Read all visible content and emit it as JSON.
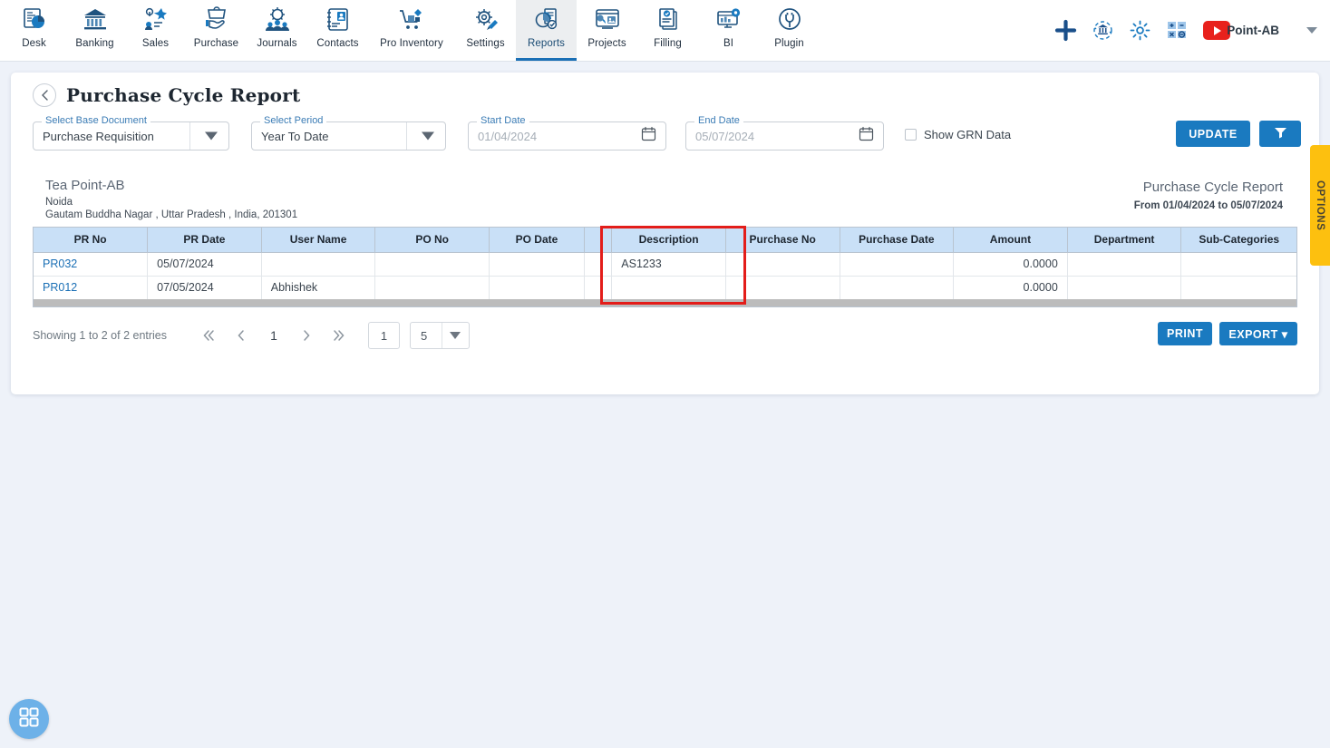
{
  "topnav": {
    "items": [
      {
        "label": "Desk",
        "icon": "dashboard-icon",
        "active": false
      },
      {
        "label": "Banking",
        "icon": "bank-icon",
        "active": false
      },
      {
        "label": "Sales",
        "icon": "sales-icon",
        "active": false
      },
      {
        "label": "Purchase",
        "icon": "purchase-icon",
        "active": false
      },
      {
        "label": "Journals",
        "icon": "journals-icon",
        "active": false
      },
      {
        "label": "Contacts",
        "icon": "contacts-icon",
        "active": false
      },
      {
        "label": "Pro Inventory",
        "icon": "inventory-icon",
        "active": false
      },
      {
        "label": "Settings",
        "icon": "settings-tools-icon",
        "active": false
      },
      {
        "label": "Reports",
        "icon": "reports-icon",
        "active": true
      },
      {
        "label": "Projects",
        "icon": "projects-icon",
        "active": false
      },
      {
        "label": "Filling",
        "icon": "filling-icon",
        "active": false
      },
      {
        "label": "BI",
        "icon": "bi-icon",
        "active": false
      },
      {
        "label": "Plugin",
        "icon": "plugin-icon",
        "active": false
      }
    ],
    "right": {
      "add_icon": "plus-icon",
      "sync_icon": "bank-sync-icon",
      "settings_icon": "gear-icon",
      "calculator_icon": "calculator-icon",
      "youtube_icon": "youtube-icon",
      "user_name": "Point-AB",
      "caret_icon": "chevron-down-icon"
    }
  },
  "page": {
    "back_icon": "chevron-left-icon",
    "title": "Purchase Cycle Report"
  },
  "filters": {
    "base_document": {
      "label": "Select Base Document",
      "value": "Purchase Requisition"
    },
    "period": {
      "label": "Select Period",
      "value": "Year To Date"
    },
    "start_date": {
      "label": "Start Date",
      "value": "01/04/2024",
      "icon": "calendar-icon"
    },
    "end_date": {
      "label": "End Date",
      "value": "05/07/2024",
      "icon": "calendar-icon"
    },
    "show_grn": {
      "label": "Show GRN Data",
      "checked": false
    },
    "update_label": "UPDATE",
    "filter_icon": "funnel-icon"
  },
  "report": {
    "org_name": "Tea Point-AB",
    "org_city": "Noida",
    "org_address": "Gautam Buddha Nagar , Uttar Pradesh , India, 201301",
    "title": "Purchase Cycle Report",
    "range": "From 01/04/2024 to 05/07/2024"
  },
  "table": {
    "columns": [
      "PR No",
      "PR Date",
      "User Name",
      "PO No",
      "PO Date",
      "",
      "Description",
      "Purchase No",
      "Purchase Date",
      "Amount",
      "Department",
      "Sub-Categories"
    ],
    "rows": [
      {
        "pr_no": "PR032",
        "pr_date": "05/07/2024",
        "user_name": "",
        "po_no": "",
        "po_date": "",
        "blank": "",
        "description": "AS1233",
        "purchase_no": "",
        "purchase_date": "",
        "amount": "0.0000",
        "department": "",
        "sub_categories": ""
      },
      {
        "pr_no": "PR012",
        "pr_date": "07/05/2024",
        "user_name": "Abhishek",
        "po_no": "",
        "po_date": "",
        "blank": "",
        "description": "",
        "purchase_no": "",
        "purchase_date": "",
        "amount": "0.0000",
        "department": "",
        "sub_categories": ""
      }
    ],
    "highlight": {
      "color": "#e31d1a",
      "columns": [
        "",
        "Description"
      ]
    }
  },
  "footer": {
    "showing": "Showing 1 to 2 of 2 entries",
    "first_icon": "double-chevron-left-icon",
    "prev_icon": "chevron-left-icon",
    "current_page": "1",
    "next_icon": "chevron-right-icon",
    "last_icon": "double-chevron-right-icon",
    "page_input_value": "1",
    "page_size_value": "5",
    "print_label": "PRINT",
    "export_label": "EXPORT ▾"
  },
  "options_tab": {
    "label": "OPTIONS",
    "color": "#fdc00f"
  },
  "fab": {
    "icon": "grid-apps-icon"
  },
  "colors": {
    "accent": "#1a7ac0",
    "link": "#1a6fb5",
    "table_header": "#c9e0f7",
    "page_bg": "#eef2f9",
    "highlight": "#e31d1a",
    "options": "#fdc00f"
  }
}
